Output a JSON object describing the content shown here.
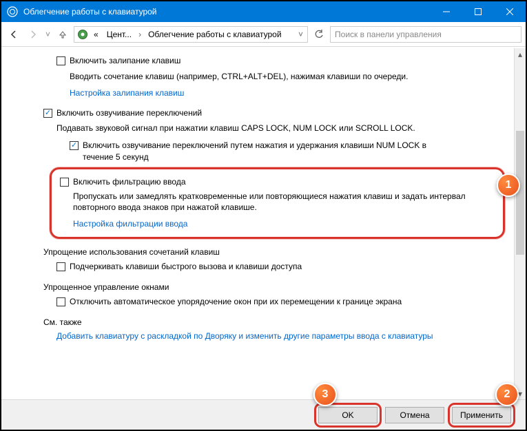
{
  "titlebar": {
    "title": "Облегчение работы с клавиатурой"
  },
  "nav": {
    "bc_prefix": "«",
    "bc1": "Цент...",
    "bc2": "Облегчение работы с клавиатурой",
    "search_placeholder": "Поиск в панели управления"
  },
  "sticky": {
    "cb": "Включить залипание клавиш",
    "desc": "Вводить сочетание клавиш (например, CTRL+ALT+DEL), нажимая клавиши по очереди.",
    "link": "Настройка залипания клавиш"
  },
  "toggle": {
    "cb": "Включить озвучивание переключений",
    "desc": "Подавать звуковой сигнал при нажатии клавиш CAPS LOCK, NUM LOCK или SCROLL LOCK.",
    "sub_cb": "Включить озвучивание переключений путем нажатия и удержания клавиши NUM LOCK в течение 5 секунд"
  },
  "filter": {
    "cb": "Включить фильтрацию ввода",
    "desc": "Пропускать или замедлять кратковременные или повторяющиеся нажатия клавиш и задать интервал повторного ввода знаков при нажатой клавише.",
    "link": "Настройка фильтрации ввода"
  },
  "shortcuts": {
    "heading": "Упрощение использования сочетаний клавиш",
    "cb": "Подчеркивать клавиши быстрого вызова и клавиши доступа"
  },
  "windows": {
    "heading": "Упрощенное управление окнами",
    "cb": "Отключить автоматическое упорядочение окон при их перемещении к границе экрана"
  },
  "seealso": {
    "heading": "См. также",
    "link": "Добавить клавиатуру с раскладкой по Дворяку и изменить другие параметры ввода с клавиатуры"
  },
  "footer": {
    "ok": "OK",
    "cancel": "Отмена",
    "apply": "Применить"
  },
  "markers": {
    "m1": "1",
    "m2": "2",
    "m3": "3"
  }
}
